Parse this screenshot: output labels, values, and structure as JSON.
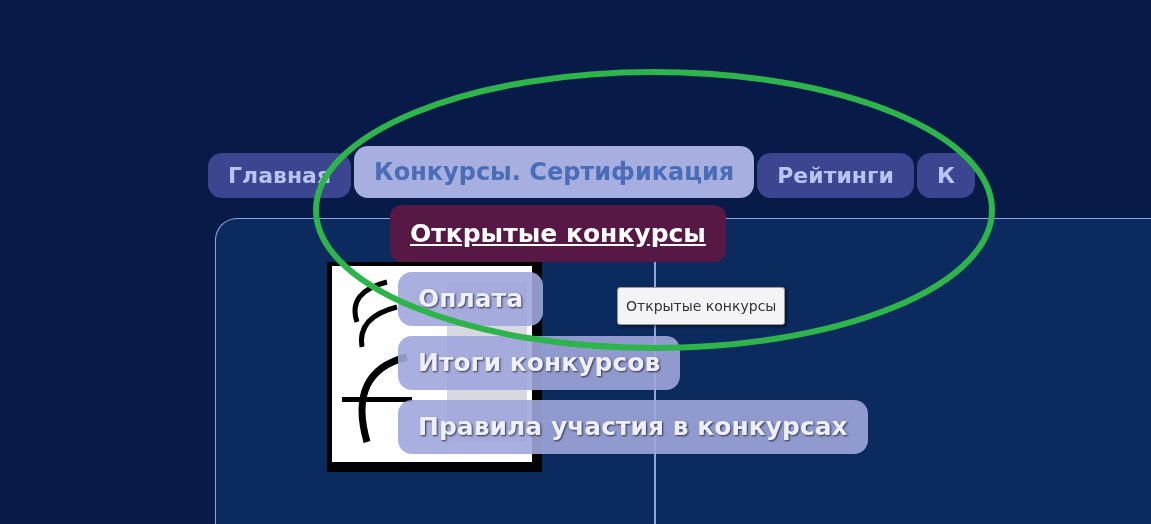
{
  "tabs": [
    {
      "label": "Главная",
      "selected": false
    },
    {
      "label": "Конкурсы. Сертификация",
      "selected": true
    },
    {
      "label": "Рейтинги",
      "selected": false
    },
    {
      "label": "К",
      "selected": false
    }
  ],
  "dropdown": {
    "items": [
      {
        "label": "Открытые конкурсы",
        "highlighted": true
      },
      {
        "label": "Оплата",
        "highlighted": false
      },
      {
        "label": "Итоги конкурсов",
        "highlighted": false
      },
      {
        "label": "Правила участия в конкурсах",
        "highlighted": false
      }
    ]
  },
  "tooltip": {
    "text": "Открытые конкурсы"
  }
}
